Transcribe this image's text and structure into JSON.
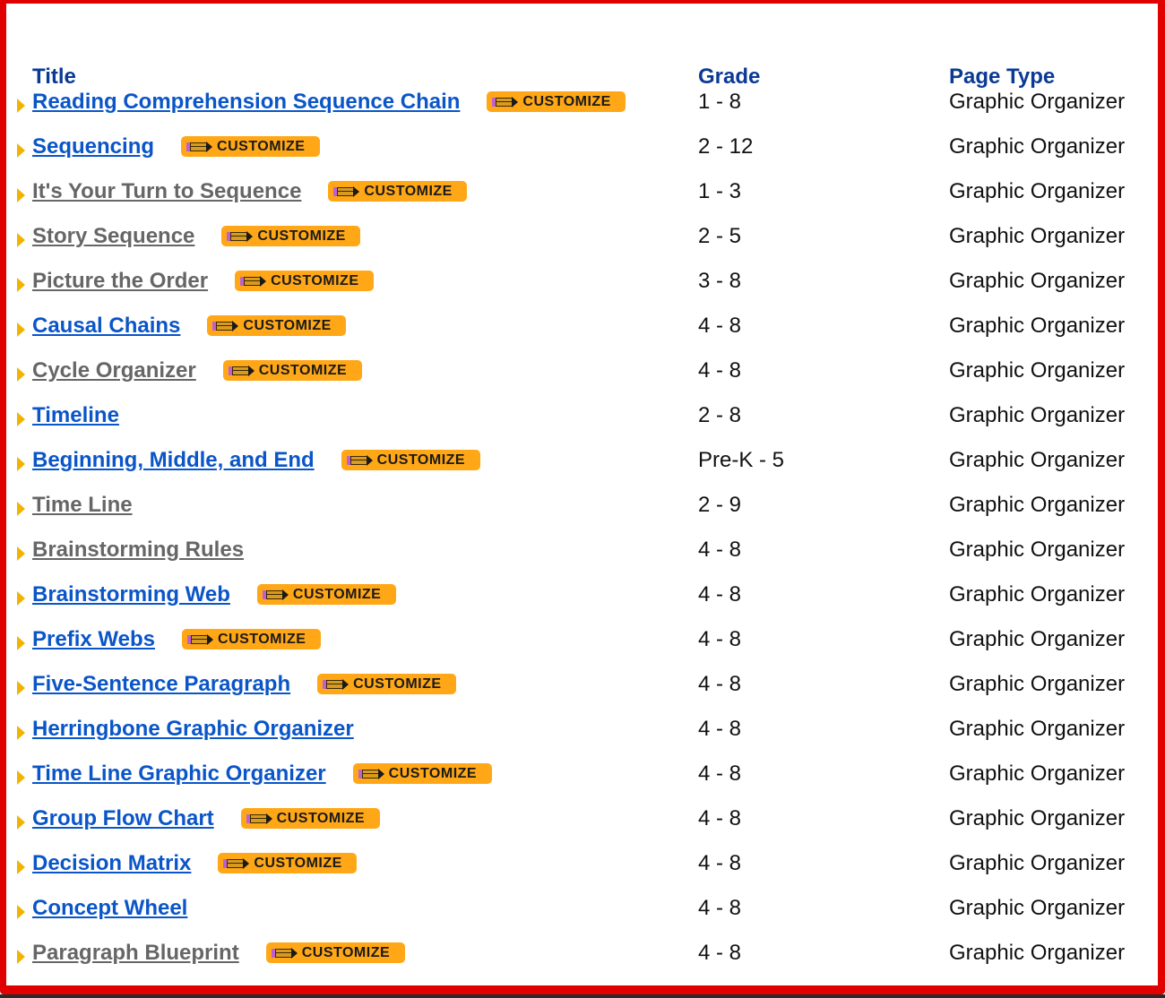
{
  "headers": {
    "title": "Title",
    "grade": "Grade",
    "page_type": "Page Type"
  },
  "customize_label": "CUSTOMIZE",
  "colors": {
    "border": "#e00000",
    "header": "#0a3a94",
    "link_unvisited": "#0a55c8",
    "link_visited": "#666666",
    "customize_bg": "#ffa716",
    "bullet": "#f0b400"
  },
  "rows": [
    {
      "title": "Reading Comprehension Sequence Chain",
      "visited": false,
      "customize": true,
      "grade": "1 - 8",
      "page_type": "Graphic Organizer"
    },
    {
      "title": "Sequencing",
      "visited": false,
      "customize": true,
      "grade": "2 - 12",
      "page_type": "Graphic Organizer"
    },
    {
      "title": "It's Your Turn to Sequence",
      "visited": true,
      "customize": true,
      "grade": "1 - 3",
      "page_type": "Graphic Organizer"
    },
    {
      "title": "Story Sequence",
      "visited": true,
      "customize": true,
      "grade": "2 - 5",
      "page_type": "Graphic Organizer"
    },
    {
      "title": "Picture the Order",
      "visited": true,
      "customize": true,
      "grade": "3 - 8",
      "page_type": "Graphic Organizer"
    },
    {
      "title": "Causal Chains",
      "visited": false,
      "customize": true,
      "grade": "4 - 8",
      "page_type": "Graphic Organizer"
    },
    {
      "title": "Cycle Organizer",
      "visited": true,
      "customize": true,
      "grade": "4 - 8",
      "page_type": "Graphic Organizer"
    },
    {
      "title": "Timeline",
      "visited": false,
      "customize": false,
      "grade": "2 - 8",
      "page_type": "Graphic Organizer"
    },
    {
      "title": "Beginning, Middle, and End",
      "visited": false,
      "customize": true,
      "grade": "Pre-K - 5",
      "page_type": "Graphic Organizer"
    },
    {
      "title": "Time Line",
      "visited": true,
      "customize": false,
      "grade": "2 - 9",
      "page_type": "Graphic Organizer"
    },
    {
      "title": "Brainstorming Rules",
      "visited": true,
      "customize": false,
      "grade": "4 - 8",
      "page_type": "Graphic Organizer"
    },
    {
      "title": "Brainstorming Web",
      "visited": false,
      "customize": true,
      "grade": "4 - 8",
      "page_type": "Graphic Organizer"
    },
    {
      "title": "Prefix Webs",
      "visited": false,
      "customize": true,
      "grade": "4 - 8",
      "page_type": "Graphic Organizer"
    },
    {
      "title": "Five-Sentence Paragraph",
      "visited": false,
      "customize": true,
      "grade": "4 - 8",
      "page_type": "Graphic Organizer"
    },
    {
      "title": "Herringbone Graphic Organizer",
      "visited": false,
      "customize": false,
      "grade": "4 - 8",
      "page_type": "Graphic Organizer"
    },
    {
      "title": "Time Line Graphic Organizer",
      "visited": false,
      "customize": true,
      "grade": "4 - 8",
      "page_type": "Graphic Organizer"
    },
    {
      "title": "Group Flow Chart",
      "visited": false,
      "customize": true,
      "grade": "4 - 8",
      "page_type": "Graphic Organizer"
    },
    {
      "title": "Decision Matrix",
      "visited": false,
      "customize": true,
      "grade": "4 - 8",
      "page_type": "Graphic Organizer"
    },
    {
      "title": "Concept Wheel",
      "visited": false,
      "customize": false,
      "grade": "4 - 8",
      "page_type": "Graphic Organizer"
    },
    {
      "title": "Paragraph Blueprint",
      "visited": true,
      "customize": true,
      "grade": "4 - 8",
      "page_type": "Graphic Organizer"
    }
  ]
}
